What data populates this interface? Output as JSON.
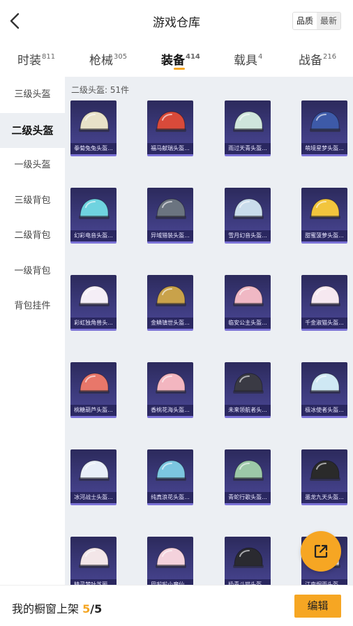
{
  "header": {
    "title": "游戏仓库",
    "sort_options": [
      "品质",
      "最新"
    ]
  },
  "tabs": [
    {
      "label": "时装",
      "count": "811"
    },
    {
      "label": "枪械",
      "count": "305"
    },
    {
      "label": "装备",
      "count": "414"
    },
    {
      "label": "载具",
      "count": "4"
    },
    {
      "label": "战备",
      "count": "216"
    }
  ],
  "sidebar": {
    "items": [
      "三级头盔",
      "二级头盔",
      "一级头盔",
      "三级背包",
      "二级背包",
      "一级背包",
      "背包挂件"
    ],
    "active_index": 1
  },
  "content": {
    "count_label": "二级头盔: 51件",
    "items": [
      {
        "name": "拳菊兔兔头盔...",
        "color": "#e8e2c8"
      },
      {
        "name": "福马献瑞头盔...",
        "color": "#d94a3a"
      },
      {
        "name": "雨过天青头盔...",
        "color": "#cfe6dc"
      },
      {
        "name": "萌境星梦头盔...",
        "color": "#3d5aa8"
      },
      {
        "name": "幻彩电音头盔...",
        "color": "#6fd3e0"
      },
      {
        "name": "异域猎装头盔...",
        "color": "#6b7480"
      },
      {
        "name": "雪月幻音头盔...",
        "color": "#c9dceb"
      },
      {
        "name": "甜蜜菠萝头盔...",
        "color": "#f2c53d"
      },
      {
        "name": "彩虹独角兽头...",
        "color": "#f4eef6"
      },
      {
        "name": "金鳞镇世头盔...",
        "color": "#c9a24a"
      },
      {
        "name": "临安公主头盔...",
        "color": "#f0b8c4"
      },
      {
        "name": "千金淑猫头盔...",
        "color": "#f6e8f0"
      },
      {
        "name": "桃糖葫芦头盔...",
        "color": "#e8776a"
      },
      {
        "name": "香桃花海头盔...",
        "color": "#f3b6c0"
      },
      {
        "name": "未来领航者头...",
        "color": "#3a3a44"
      },
      {
        "name": "极冰使者头盔...",
        "color": "#cfe8f4"
      },
      {
        "name": "冰河战士头盔...",
        "color": "#e8eef8"
      },
      {
        "name": "纯真浪花头盔...",
        "color": "#7cc6e0"
      },
      {
        "name": "青蛇行歌头盔...",
        "color": "#9cc8a8"
      },
      {
        "name": "墨龙九天头盔...",
        "color": "#2a2a2a"
      },
      {
        "name": "精灵梦叶芝丽...",
        "color": "#f3e6e8"
      },
      {
        "name": "巴啦啦小魔仙...",
        "color": "#f4d2dc"
      },
      {
        "name": "奶青斗喵头盔...",
        "color": "#2a2a30"
      },
      {
        "name": "江南烟雨头盔...",
        "color": "#e8e4ea"
      }
    ]
  },
  "footer": {
    "text": "我的橱窗上架",
    "current": "5",
    "separator": "/",
    "total": "5",
    "edit_label": "编辑"
  },
  "colors": {
    "accent": "#f6a623",
    "card_bg": "#3c3a7c",
    "content_bg": "#eceff3"
  },
  "icons": {
    "back": "chevron-left-icon",
    "share": "external-link-icon"
  }
}
